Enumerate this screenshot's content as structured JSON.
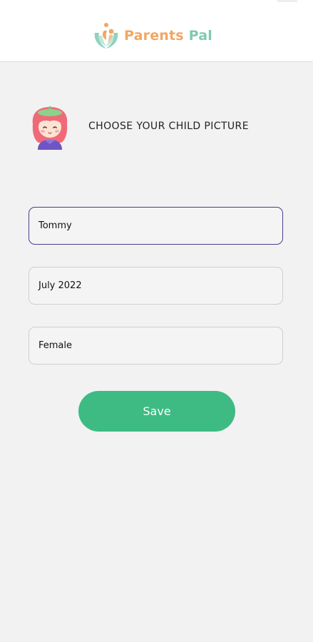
{
  "header": {
    "logo_word1": "Parents",
    "logo_word2": "Pal"
  },
  "picker": {
    "avatar_icon": "girl-avatar-icon",
    "label": "CHOOSE YOUR CHILD PICTURE"
  },
  "form": {
    "name_value": "Tommy",
    "birth_value": "July 2022",
    "gender_value": "Female"
  },
  "actions": {
    "save_label": "Save"
  },
  "colors": {
    "background": "#f2f2f2",
    "header": "#ffffff",
    "accent_orange": "#f2a663",
    "accent_mint": "#7ccbb0",
    "save_button": "#3dbb83",
    "focus_border": "#4a3c8c"
  }
}
